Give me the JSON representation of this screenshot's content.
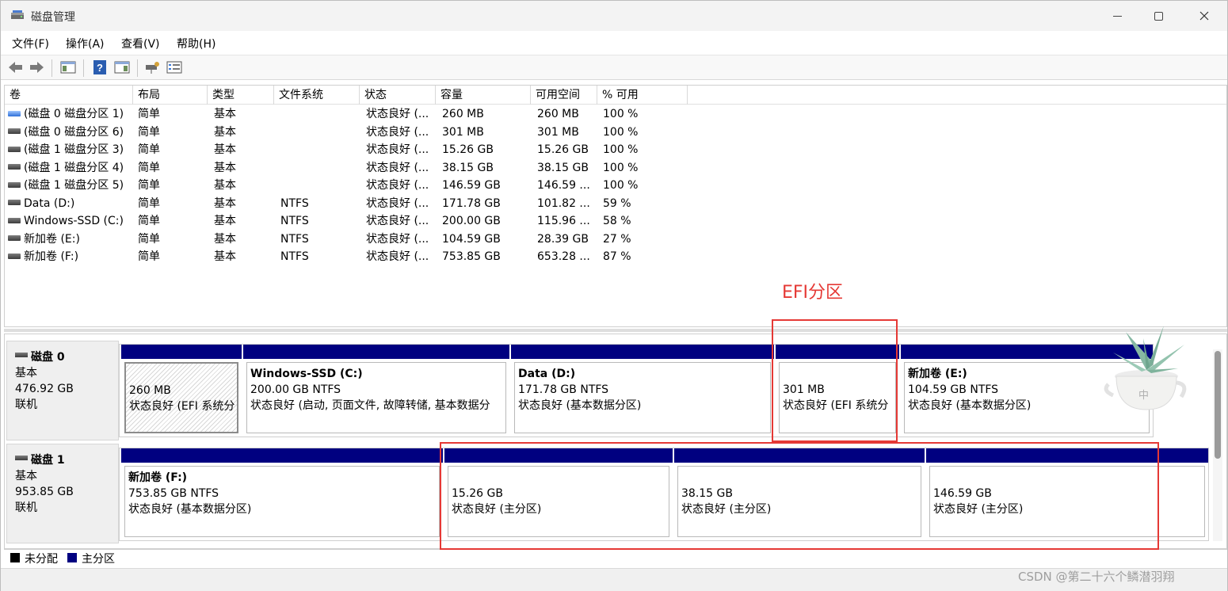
{
  "window": {
    "title": "磁盘管理"
  },
  "menu": [
    "文件(F)",
    "操作(A)",
    "查看(V)",
    "帮助(H)"
  ],
  "toolbar_icons": [
    "back-icon",
    "forward-icon",
    "console-tree-icon",
    "help-icon",
    "properties-icon",
    "connect-icon",
    "list-icon"
  ],
  "columns": [
    "卷",
    "布局",
    "类型",
    "文件系统",
    "状态",
    "容量",
    "可用空间",
    "% 可用"
  ],
  "volumes": [
    {
      "name": "(磁盘 0 磁盘分区 1)",
      "layout": "简单",
      "type": "基本",
      "fs": "",
      "status": "状态良好 (...",
      "capacity": "260 MB",
      "free": "260 MB",
      "pct": "100 %",
      "icon": "blue"
    },
    {
      "name": "(磁盘 0 磁盘分区 6)",
      "layout": "简单",
      "type": "基本",
      "fs": "",
      "status": "状态良好 (...",
      "capacity": "301 MB",
      "free": "301 MB",
      "pct": "100 %",
      "icon": "gray"
    },
    {
      "name": "(磁盘 1 磁盘分区 3)",
      "layout": "简单",
      "type": "基本",
      "fs": "",
      "status": "状态良好 (...",
      "capacity": "15.26 GB",
      "free": "15.26 GB",
      "pct": "100 %",
      "icon": "gray"
    },
    {
      "name": "(磁盘 1 磁盘分区 4)",
      "layout": "简单",
      "type": "基本",
      "fs": "",
      "status": "状态良好 (...",
      "capacity": "38.15 GB",
      "free": "38.15 GB",
      "pct": "100 %",
      "icon": "gray"
    },
    {
      "name": "(磁盘 1 磁盘分区 5)",
      "layout": "简单",
      "type": "基本",
      "fs": "",
      "status": "状态良好 (...",
      "capacity": "146.59 GB",
      "free": "146.59 ...",
      "pct": "100 %",
      "icon": "gray"
    },
    {
      "name": "Data (D:)",
      "layout": "简单",
      "type": "基本",
      "fs": "NTFS",
      "status": "状态良好 (...",
      "capacity": "171.78 GB",
      "free": "101.82 ...",
      "pct": "59 %",
      "icon": "gray"
    },
    {
      "name": "Windows-SSD (C:)",
      "layout": "简单",
      "type": "基本",
      "fs": "NTFS",
      "status": "状态良好 (...",
      "capacity": "200.00 GB",
      "free": "115.96 ...",
      "pct": "58 %",
      "icon": "gray"
    },
    {
      "name": "新加卷 (E:)",
      "layout": "简单",
      "type": "基本",
      "fs": "NTFS",
      "status": "状态良好 (...",
      "capacity": "104.59 GB",
      "free": "28.39 GB",
      "pct": "27 %",
      "icon": "gray"
    },
    {
      "name": "新加卷 (F:)",
      "layout": "简单",
      "type": "基本",
      "fs": "NTFS",
      "status": "状态良好 (...",
      "capacity": "753.85 GB",
      "free": "653.28 ...",
      "pct": "87 %",
      "icon": "gray"
    }
  ],
  "disks": [
    {
      "name": "磁盘 0",
      "kind": "基本",
      "size": "476.92 GB",
      "state": "联机",
      "partitions": [
        {
          "title": "",
          "line1": "260 MB",
          "line2": "状态良好 (EFI 系统分",
          "hatched": true
        },
        {
          "title": "Windows-SSD  (C:)",
          "line1": "200.00 GB NTFS",
          "line2": "状态良好 (启动, 页面文件, 故障转储, 基本数据分",
          "hatched": false
        },
        {
          "title": "Data  (D:)",
          "line1": "171.78 GB NTFS",
          "line2": "状态良好 (基本数据分区)",
          "hatched": false
        },
        {
          "title": "",
          "line1": "301 MB",
          "line2": "状态良好 (EFI 系统分",
          "hatched": false
        },
        {
          "title": "新加卷  (E:)",
          "line1": "104.59 GB NTFS",
          "line2": "状态良好 (基本数据分区)",
          "hatched": false
        }
      ]
    },
    {
      "name": "磁盘 1",
      "kind": "基本",
      "size": "953.85 GB",
      "state": "联机",
      "partitions": [
        {
          "title": "新加卷  (F:)",
          "line1": "753.85 GB NTFS",
          "line2": "状态良好 (基本数据分区)",
          "hatched": false
        },
        {
          "title": "",
          "line1": "15.26 GB",
          "line2": "状态良好 (主分区)",
          "hatched": false
        },
        {
          "title": "",
          "line1": "38.15 GB",
          "line2": "状态良好 (主分区)",
          "hatched": false
        },
        {
          "title": "",
          "line1": "146.59 GB",
          "line2": "状态良好 (主分区)",
          "hatched": false
        }
      ]
    }
  ],
  "legend": [
    {
      "label": "未分配",
      "color": "#000000"
    },
    {
      "label": "主分区",
      "color": "#000080"
    }
  ],
  "annotation": {
    "label": "EFI分区",
    "color": "#e53935"
  },
  "watermark": "CSDN @第二十六个鳞潜羽翔"
}
